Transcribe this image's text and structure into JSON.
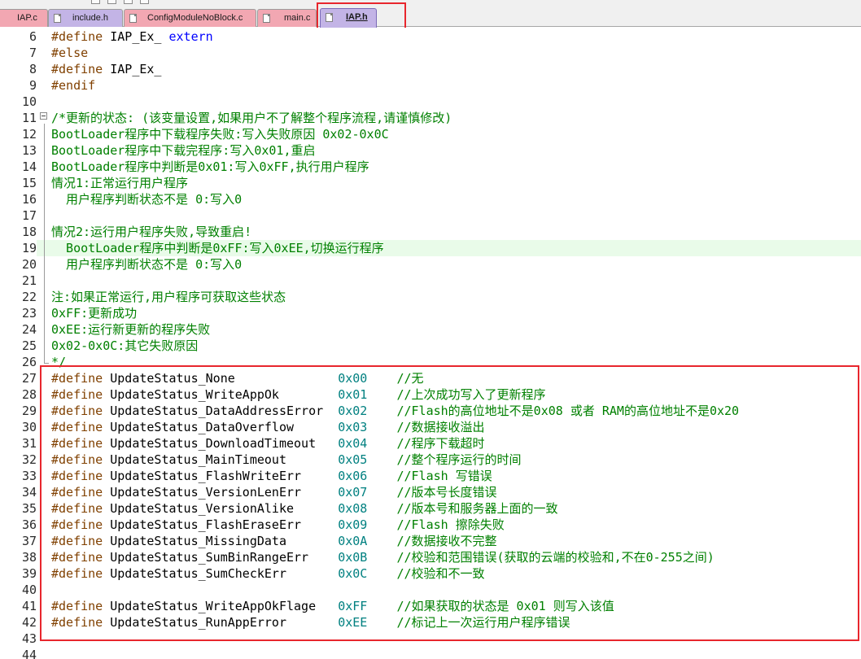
{
  "tabs": [
    {
      "label": "IAP.c",
      "kind": "c"
    },
    {
      "label": "include.h",
      "kind": "h"
    },
    {
      "label": "ConfigModuleNoBlock.c",
      "kind": "c"
    },
    {
      "label": "main.c",
      "kind": "c"
    },
    {
      "label": "IAP.h",
      "kind": "h",
      "active": true
    }
  ],
  "editor": {
    "current_line": 19,
    "lines": [
      {
        "n": "6",
        "segs": [
          [
            "pp",
            "#define "
          ],
          [
            "id",
            "IAP_Ex_ "
          ],
          [
            "kw",
            "extern"
          ]
        ]
      },
      {
        "n": "7",
        "segs": [
          [
            "pp",
            "#else"
          ]
        ]
      },
      {
        "n": "8",
        "segs": [
          [
            "pp",
            "#define "
          ],
          [
            "id",
            "IAP_Ex_"
          ]
        ]
      },
      {
        "n": "9",
        "segs": [
          [
            "pp",
            "#endif"
          ]
        ]
      },
      {
        "n": "10",
        "segs": []
      },
      {
        "n": "11",
        "segs": [
          [
            "cmt",
            "/*更新的状态: (该变量设置,如果用户不了解整个程序流程,请谨慎修改)"
          ]
        ]
      },
      {
        "n": "12",
        "segs": [
          [
            "cmt",
            "BootLoader程序中下载程序失败:写入失败原因 0x02-0x0C"
          ]
        ]
      },
      {
        "n": "13",
        "segs": [
          [
            "cmt",
            "BootLoader程序中下载完程序:写入0x01,重启"
          ]
        ]
      },
      {
        "n": "14",
        "segs": [
          [
            "cmt",
            "BootLoader程序中判断是0x01:写入0xFF,执行用户程序"
          ]
        ]
      },
      {
        "n": "15",
        "segs": [
          [
            "cmt",
            "情况1:正常运行用户程序"
          ]
        ]
      },
      {
        "n": "16",
        "segs": [
          [
            "cmt",
            "  用户程序判断状态不是 0:写入0"
          ]
        ]
      },
      {
        "n": "17",
        "segs": []
      },
      {
        "n": "18",
        "segs": [
          [
            "cmt",
            "情况2:运行用户程序失败,导致重启!"
          ]
        ]
      },
      {
        "n": "19",
        "segs": [
          [
            "cmt",
            "  BootLoader程序中判断是0xFF:写入0xEE,切换运行程序"
          ]
        ]
      },
      {
        "n": "20",
        "segs": [
          [
            "cmt",
            "  用户程序判断状态不是 0:写入0"
          ]
        ]
      },
      {
        "n": "21",
        "segs": []
      },
      {
        "n": "22",
        "segs": [
          [
            "cmt",
            "注:如果正常运行,用户程序可获取这些状态"
          ]
        ]
      },
      {
        "n": "23",
        "segs": [
          [
            "cmt",
            "0xFF:更新成功"
          ]
        ]
      },
      {
        "n": "24",
        "segs": [
          [
            "cmt",
            "0xEE:运行新更新的程序失败"
          ]
        ]
      },
      {
        "n": "25",
        "segs": [
          [
            "cmt",
            "0x02-0x0C:其它失败原因"
          ]
        ]
      },
      {
        "n": "26",
        "segs": [
          [
            "cmt",
            "*/"
          ]
        ]
      },
      {
        "n": "27",
        "segs": [
          [
            "pp",
            "#define "
          ],
          [
            "id",
            "UpdateStatus_None              "
          ],
          [
            "hex",
            "0x00"
          ],
          [
            "id",
            "    "
          ],
          [
            "cmt",
            "//无"
          ]
        ]
      },
      {
        "n": "28",
        "segs": [
          [
            "pp",
            "#define "
          ],
          [
            "id",
            "UpdateStatus_WriteAppOk        "
          ],
          [
            "hex",
            "0x01"
          ],
          [
            "id",
            "    "
          ],
          [
            "cmt",
            "//上次成功写入了更新程序"
          ]
        ]
      },
      {
        "n": "29",
        "segs": [
          [
            "pp",
            "#define "
          ],
          [
            "id",
            "UpdateStatus_DataAddressError  "
          ],
          [
            "hex",
            "0x02"
          ],
          [
            "id",
            "    "
          ],
          [
            "cmt",
            "//Flash的高位地址不是0x08 或者 RAM的高位地址不是0x20"
          ]
        ]
      },
      {
        "n": "30",
        "segs": [
          [
            "pp",
            "#define "
          ],
          [
            "id",
            "UpdateStatus_DataOverflow      "
          ],
          [
            "hex",
            "0x03"
          ],
          [
            "id",
            "    "
          ],
          [
            "cmt",
            "//数据接收溢出"
          ]
        ]
      },
      {
        "n": "31",
        "segs": [
          [
            "pp",
            "#define "
          ],
          [
            "id",
            "UpdateStatus_DownloadTimeout   "
          ],
          [
            "hex",
            "0x04"
          ],
          [
            "id",
            "    "
          ],
          [
            "cmt",
            "//程序下载超时"
          ]
        ]
      },
      {
        "n": "32",
        "segs": [
          [
            "pp",
            "#define "
          ],
          [
            "id",
            "UpdateStatus_MainTimeout       "
          ],
          [
            "hex",
            "0x05"
          ],
          [
            "id",
            "    "
          ],
          [
            "cmt",
            "//整个程序运行的时间"
          ]
        ]
      },
      {
        "n": "33",
        "segs": [
          [
            "pp",
            "#define "
          ],
          [
            "id",
            "UpdateStatus_FlashWriteErr     "
          ],
          [
            "hex",
            "0x06"
          ],
          [
            "id",
            "    "
          ],
          [
            "cmt",
            "//Flash 写错误"
          ]
        ]
      },
      {
        "n": "34",
        "segs": [
          [
            "pp",
            "#define "
          ],
          [
            "id",
            "UpdateStatus_VersionLenErr     "
          ],
          [
            "hex",
            "0x07"
          ],
          [
            "id",
            "    "
          ],
          [
            "cmt",
            "//版本号长度错误"
          ]
        ]
      },
      {
        "n": "35",
        "segs": [
          [
            "pp",
            "#define "
          ],
          [
            "id",
            "UpdateStatus_VersionAlike      "
          ],
          [
            "hex",
            "0x08"
          ],
          [
            "id",
            "    "
          ],
          [
            "cmt",
            "//版本号和服务器上面的一致"
          ]
        ]
      },
      {
        "n": "36",
        "segs": [
          [
            "pp",
            "#define "
          ],
          [
            "id",
            "UpdateStatus_FlashEraseErr     "
          ],
          [
            "hex",
            "0x09"
          ],
          [
            "id",
            "    "
          ],
          [
            "cmt",
            "//Flash 擦除失败"
          ]
        ]
      },
      {
        "n": "37",
        "segs": [
          [
            "pp",
            "#define "
          ],
          [
            "id",
            "UpdateStatus_MissingData       "
          ],
          [
            "hex",
            "0x0A"
          ],
          [
            "id",
            "    "
          ],
          [
            "cmt",
            "//数据接收不完整"
          ]
        ]
      },
      {
        "n": "38",
        "segs": [
          [
            "pp",
            "#define "
          ],
          [
            "id",
            "UpdateStatus_SumBinRangeErr    "
          ],
          [
            "hex",
            "0x0B"
          ],
          [
            "id",
            "    "
          ],
          [
            "cmt",
            "//校验和范围错误(获取的云端的校验和,不在0-255之间)"
          ]
        ]
      },
      {
        "n": "39",
        "segs": [
          [
            "pp",
            "#define "
          ],
          [
            "id",
            "UpdateStatus_SumCheckErr       "
          ],
          [
            "hex",
            "0x0C"
          ],
          [
            "id",
            "    "
          ],
          [
            "cmt",
            "//校验和不一致"
          ]
        ]
      },
      {
        "n": "40",
        "segs": []
      },
      {
        "n": "41",
        "segs": [
          [
            "pp",
            "#define "
          ],
          [
            "id",
            "UpdateStatus_WriteAppOkFlage   "
          ],
          [
            "hex",
            "0xFF"
          ],
          [
            "id",
            "    "
          ],
          [
            "cmt",
            "//如果获取的状态是 0x01 则写入该值"
          ]
        ]
      },
      {
        "n": "42",
        "segs": [
          [
            "pp",
            "#define "
          ],
          [
            "id",
            "UpdateStatus_RunAppError       "
          ],
          [
            "hex",
            "0xEE"
          ],
          [
            "id",
            "    "
          ],
          [
            "cmt",
            "//标记上一次运行用户程序错误"
          ]
        ]
      },
      {
        "n": "43",
        "segs": []
      },
      {
        "n": "44",
        "segs": []
      }
    ]
  }
}
